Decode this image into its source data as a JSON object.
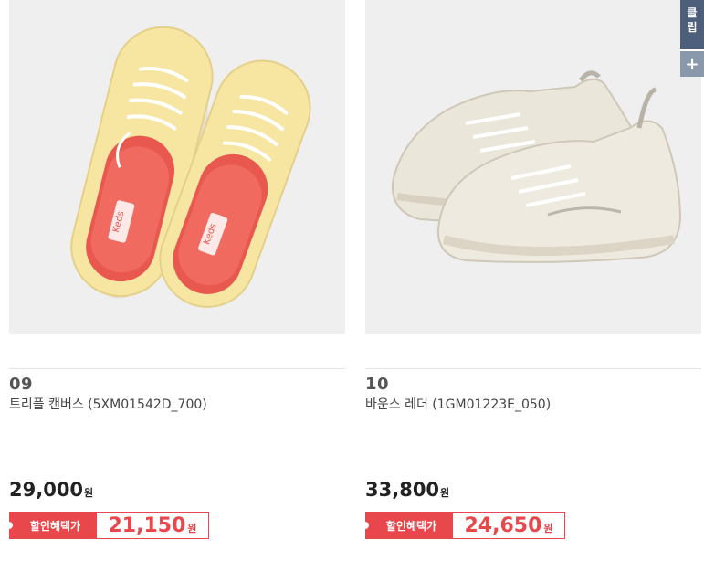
{
  "products": [
    {
      "rank": "09",
      "name": "트리플 캔버스 (5XM01542D_700)",
      "price": "29,000",
      "price_unit": "원",
      "deal_label": "할인혜택가",
      "deal_price": "21,150",
      "deal_unit": "원",
      "image": "yellow-canvas-sneakers",
      "brand_tag": "Keds",
      "colors": {
        "shoe": "#f5e6a3",
        "insole": "#e8584f"
      }
    },
    {
      "rank": "10",
      "name": "바운스 레더 (1GM01223E_050)",
      "price": "33,800",
      "price_unit": "원",
      "deal_label": "할인혜택가",
      "deal_price": "24,650",
      "deal_unit": "원",
      "image": "cream-chunky-sneakers",
      "colors": {
        "shoe": "#ece7dc"
      }
    }
  ],
  "side_widget": {
    "label_line1": "클",
    "label_line2": "립",
    "plus": "+"
  },
  "colors": {
    "accent": "#e8474c",
    "side_widget": "#4d5f7a",
    "image_bg": "#efefef"
  }
}
